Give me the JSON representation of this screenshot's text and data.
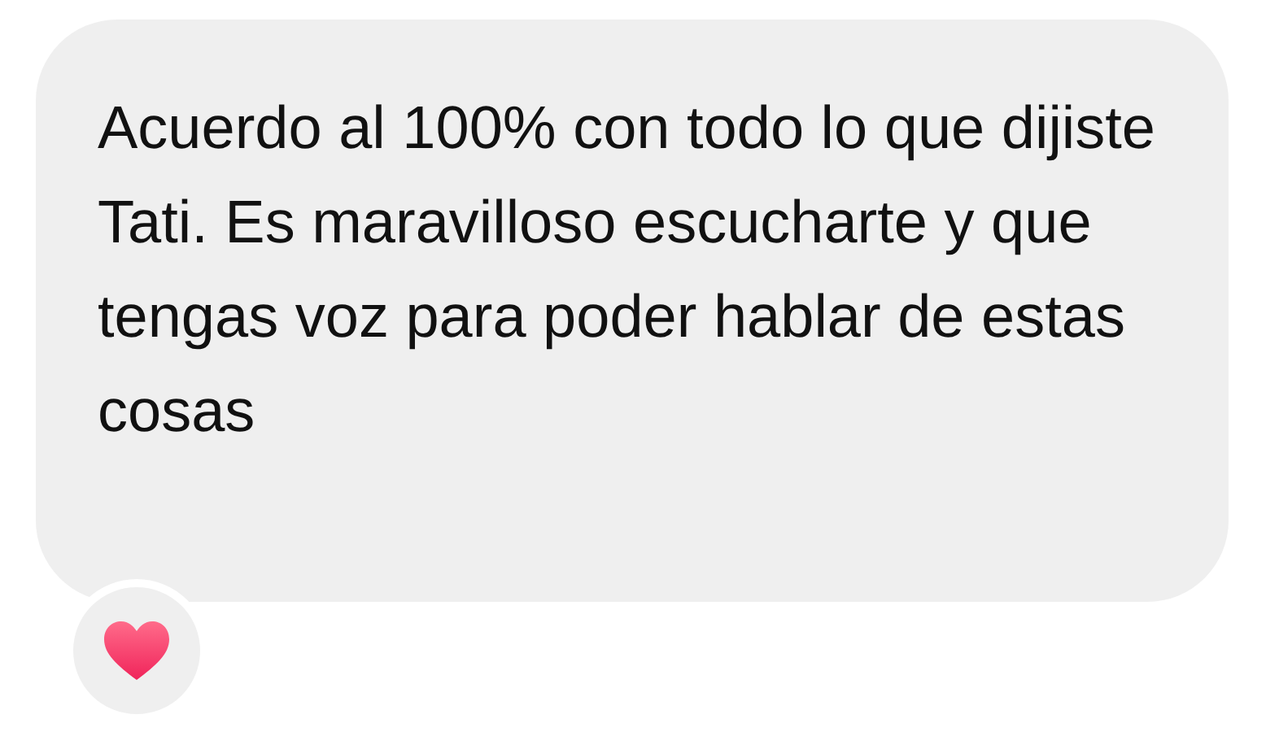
{
  "message": {
    "text": "Acuerdo al 100% con todo lo que dijiste Tati. Es maravilloso escucharte y que tengas voz para poder hablar de estas cosas"
  }
}
